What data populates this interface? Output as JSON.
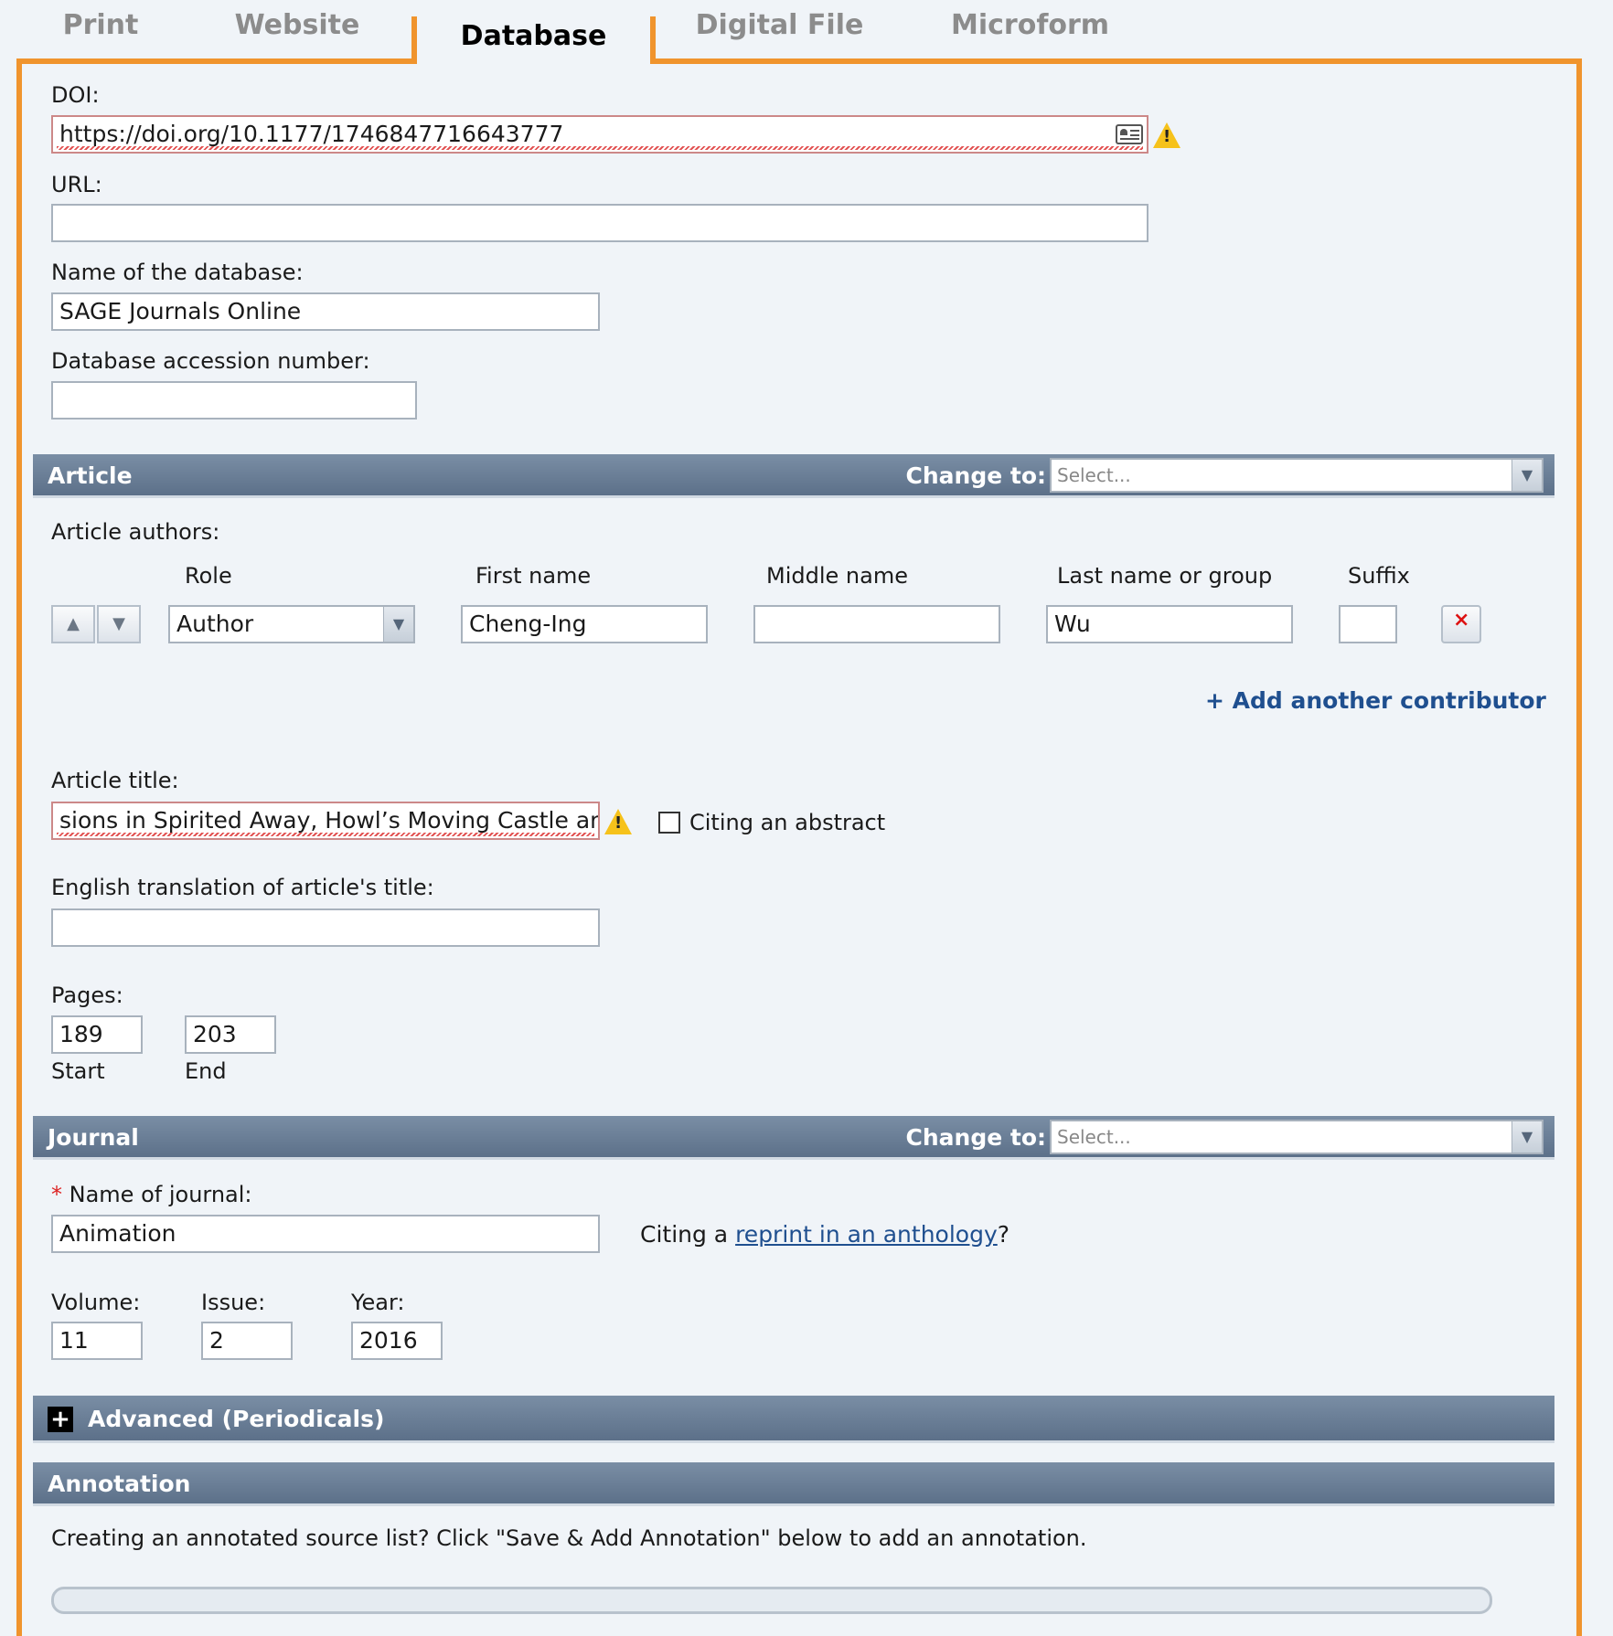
{
  "tabs": [
    "Print",
    "Website",
    "Database",
    "Digital File",
    "Microform"
  ],
  "active_tab": "Database",
  "doi": {
    "label": "DOI:",
    "value": "https://doi.org/10.1177/1746847716643777"
  },
  "url": {
    "label": "URL:",
    "value": ""
  },
  "database_name": {
    "label": "Name of the database:",
    "value": "SAGE Journals Online"
  },
  "accession": {
    "label": "Database accession number:",
    "value": ""
  },
  "article_section": {
    "title": "Article",
    "change_to": "Change to:",
    "select_placeholder": "Select..."
  },
  "authors": {
    "label": "Article authors:",
    "col_role": "Role",
    "col_first": "First name",
    "col_middle": "Middle name",
    "col_last": "Last name or group",
    "col_suffix": "Suffix",
    "rows": [
      {
        "role": "Author",
        "first": "Cheng-Ing",
        "middle": "",
        "last": "Wu",
        "suffix": ""
      }
    ],
    "add_contributor": "+ Add another contributor"
  },
  "article_title": {
    "label": "Article title:",
    "value": "sions in Spirited Away, Howl’s Moving Castle and Ponyo",
    "citing_abstract": "Citing an abstract"
  },
  "translation": {
    "label": "English translation of article's title:",
    "value": ""
  },
  "pages": {
    "label": "Pages:",
    "start": "189",
    "end": "203",
    "start_label": "Start",
    "end_label": "End"
  },
  "journal_section": {
    "title": "Journal",
    "change_to": "Change to:",
    "select_placeholder": "Select..."
  },
  "journal": {
    "required_mark": "*",
    "label": "Name of journal:",
    "value": "Animation",
    "reprint_prefix": "Citing a ",
    "reprint_link": "reprint in an anthology",
    "reprint_suffix": "?"
  },
  "volume": {
    "label": "Volume:",
    "value": "11"
  },
  "issue": {
    "label": "Issue:",
    "value": "2"
  },
  "year": {
    "label": "Year:",
    "value": "2016"
  },
  "advanced": {
    "icon": "+",
    "label": "Advanced (Periodicals)"
  },
  "annotation": {
    "title": "Annotation",
    "text": "Creating an annotated source list? Click \"Save & Add Annotation\" below to add an annotation."
  },
  "colors": {
    "accent": "#f0942d",
    "section_bar": "#6a7f97",
    "link": "#1f4f8f",
    "warning": "#f6c21b"
  }
}
